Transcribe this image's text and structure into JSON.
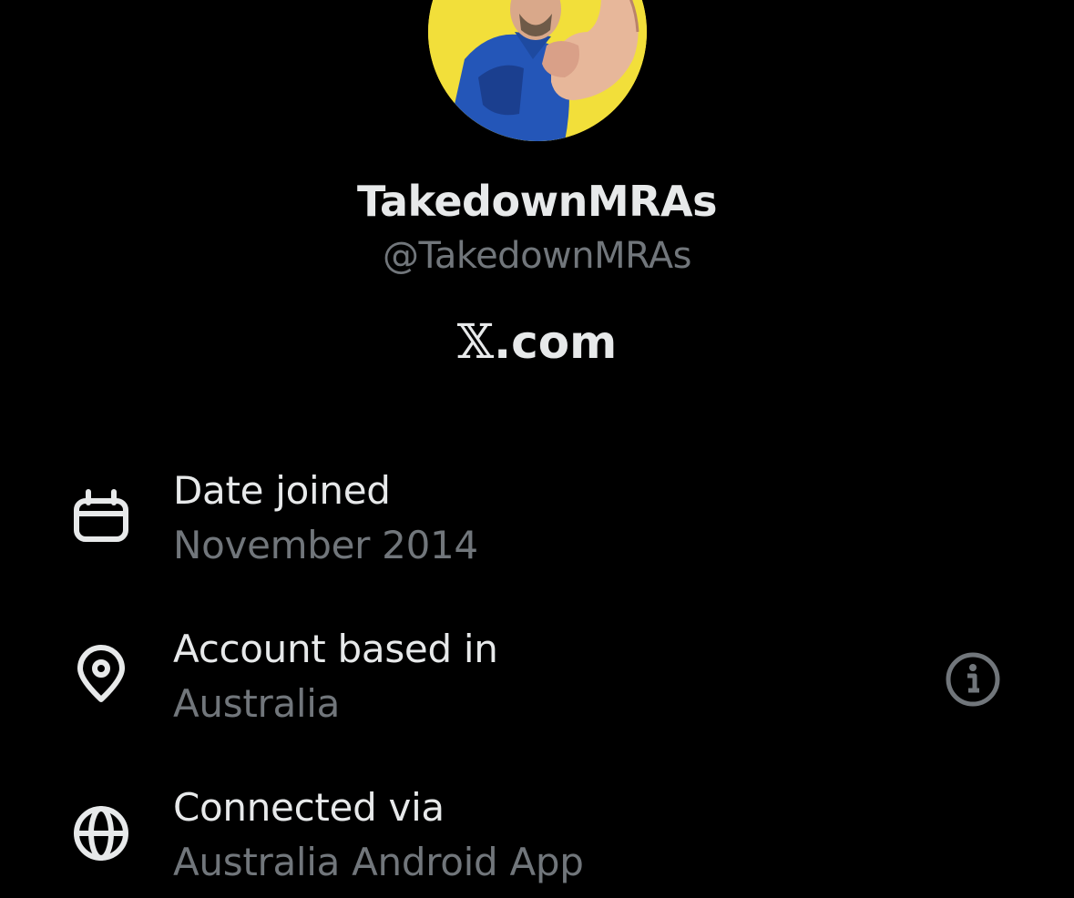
{
  "profile": {
    "display_name": "TakedownMRAs",
    "handle": "@TakedownMRAs",
    "platform_mark": "𝕏",
    "platform_suffix": ".com"
  },
  "details": [
    {
      "icon": "calendar-icon",
      "title": "Date joined",
      "value": "November 2014"
    },
    {
      "icon": "location-pin-icon",
      "title": "Account based in",
      "value": "Australia",
      "has_info": true
    },
    {
      "icon": "globe-icon",
      "title": "Connected via",
      "value": "Australia Android App"
    }
  ],
  "colors": {
    "background": "#000000",
    "primary_text": "#e7e9ea",
    "secondary_text": "#71767b",
    "avatar_background": "#f2df3a"
  }
}
